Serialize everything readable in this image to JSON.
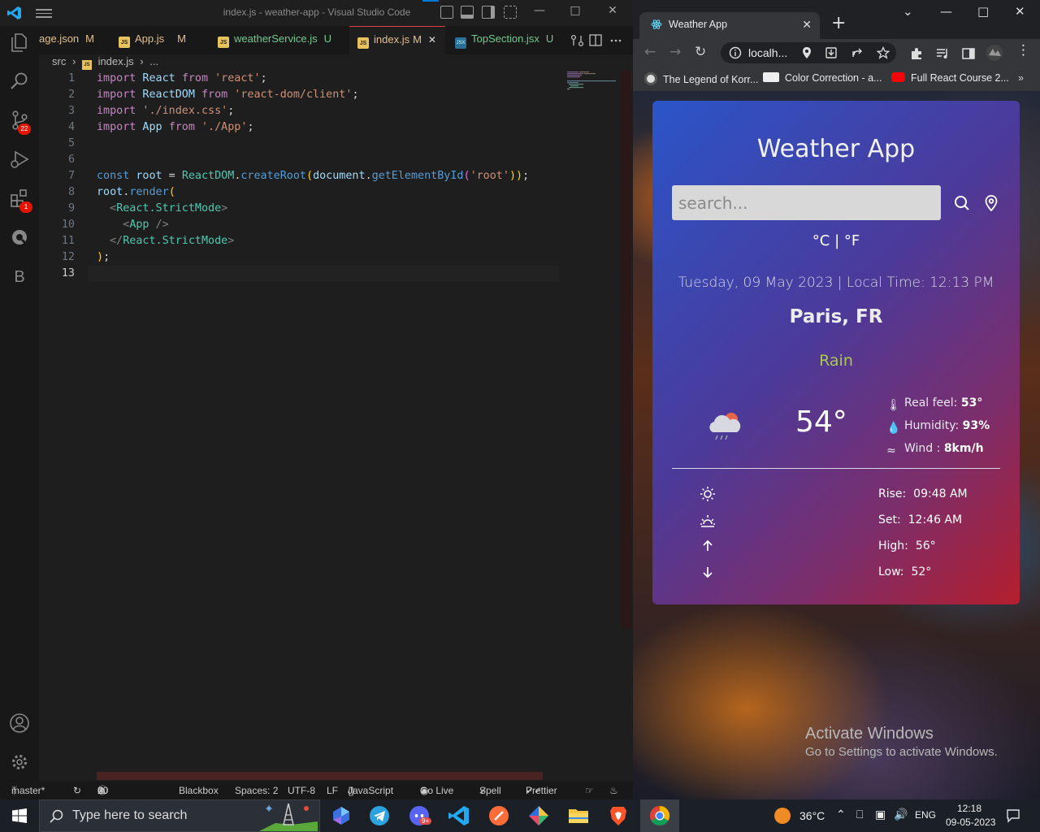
{
  "vscode": {
    "title": "index.js - weather-app - Visual Studio Code",
    "tabs": [
      {
        "label": "age.json",
        "status": "M",
        "type": "json"
      },
      {
        "label": "App.js",
        "status": "M",
        "type": "js"
      },
      {
        "label": "weatherService.js",
        "status": "U",
        "type": "js"
      },
      {
        "label": "index.js",
        "status": "M",
        "type": "js",
        "active": true
      },
      {
        "label": "TopSection.jsx",
        "status": "U",
        "type": "jsx"
      }
    ],
    "breadcrumb": {
      "folder": "src",
      "file": "index.js",
      "more": "..."
    },
    "activity": {
      "scm_badge": "22",
      "ext_badge": "1",
      "blackbox_letter": "B"
    },
    "line_numbers": [
      "1",
      "2",
      "3",
      "4",
      "5",
      "6",
      "7",
      "8",
      "9",
      "10",
      "11",
      "12",
      "13"
    ],
    "code": {
      "l1": [
        "import",
        " React ",
        "from",
        " 'react'",
        ";"
      ],
      "l2": [
        "import",
        " ReactDOM ",
        "from",
        " 'react-dom/client'",
        ";"
      ],
      "l3": [
        "import",
        " './index.css'",
        ";"
      ],
      "l4": [
        "import",
        " App ",
        "from",
        " './App'",
        ";"
      ],
      "l7": [
        "const",
        " root",
        " = ",
        "ReactDOM",
        ".",
        "createRoot",
        "(",
        "document",
        ".",
        "getElementById",
        "(",
        "'root'",
        "))",
        ";"
      ],
      "l8": [
        "root",
        ".",
        "render",
        "("
      ],
      "l9": [
        "  <",
        "React.StrictMode",
        ">"
      ],
      "l10": [
        "    <",
        "App",
        " />"
      ],
      "l11": [
        "  </",
        "React.StrictMode",
        ">"
      ],
      "l12": [
        ")",
        ";"
      ]
    },
    "status": {
      "branch": "master*",
      "errors": "0",
      "warnings": "0",
      "info": "20",
      "blackbox": "Blackbox",
      "spaces": "Spaces: 2",
      "encoding": "UTF-8",
      "eol": "LF",
      "language": "JavaScript",
      "golive": "Go Live",
      "spell": "Spell",
      "prettier": "Prettier"
    }
  },
  "browser": {
    "tab_title": "Weather App",
    "url": "localh...",
    "bookmarks": [
      "The Legend of Korr...",
      "Color Correction - a...",
      "Full React Course 2..."
    ]
  },
  "weather": {
    "app_title": "Weather App",
    "search_placeholder": "search...",
    "units": "°C | °F",
    "datetime": "Tuesday, 09 May 2023 | Local Time: 12:13 PM",
    "city": "Paris, FR",
    "condition": "Rain",
    "temperature": "54°",
    "details": {
      "real_feel_label": "Real feel:",
      "real_feel": "53°",
      "humidity_label": "Humidity:",
      "humidity": "93%",
      "wind_label": "Wind :",
      "wind": "8km/h"
    },
    "sun": [
      {
        "label": "Rise:",
        "value": "09:48 AM",
        "icon": "sunrise-icon"
      },
      {
        "label": "Set:",
        "value": "12:46 AM",
        "icon": "sunset-icon"
      },
      {
        "label": "High:",
        "value": "56°",
        "icon": "arrow-up-icon"
      },
      {
        "label": "Low:",
        "value": "52°",
        "icon": "arrow-down-icon"
      }
    ],
    "colors": {
      "condition": "#a8c94e",
      "card_start": "#2a55c9",
      "card_end": "#b41e2d"
    }
  },
  "windows": {
    "activate_title": "Activate Windows",
    "activate_sub": "Go to Settings to activate Windows."
  },
  "taskbar": {
    "search_placeholder": "Type here to search",
    "discord_badge": "9+",
    "temperature": "36°C",
    "language": "ENG",
    "time": "12:18",
    "date": "09-05-2023"
  }
}
